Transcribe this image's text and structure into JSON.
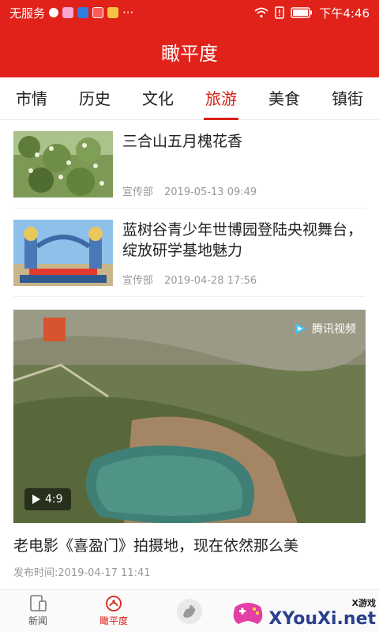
{
  "status_bar": {
    "carrier": "无服务",
    "time": "下午4:46"
  },
  "app_title": "瞰平度",
  "tabs": [
    {
      "label": "市情"
    },
    {
      "label": "历史"
    },
    {
      "label": "文化"
    },
    {
      "label": "旅游"
    },
    {
      "label": "美食"
    },
    {
      "label": "镇街"
    }
  ],
  "active_tab": "旅游",
  "news": [
    {
      "title": "三合山五月槐花香",
      "source": "宣传部",
      "date": "2019-05-13 09:49"
    },
    {
      "title": "蓝树谷青少年世博园登陆央视舞台，绽放研学基地魅力",
      "source": "宣传部",
      "date": "2019-04-28 17:56"
    }
  ],
  "video": {
    "duration": "4:9",
    "provider": "腾讯视频",
    "title": "老电影《喜盈门》拍摄地，现在依然那么美",
    "published": "发布时间:2019-04-17 11:41"
  },
  "bottom_nav": [
    {
      "label": "新闻",
      "icon": "phone-icon"
    },
    {
      "label": "瞰平度",
      "icon": "compass-icon"
    },
    {
      "label": "",
      "icon": "hand-icon"
    },
    {
      "label": "",
      "icon": "hidden-icon"
    },
    {
      "label": "",
      "icon": "hidden-icon"
    }
  ],
  "watermark": {
    "text": "XYouXi.net",
    "small": "X游戏"
  },
  "colors": {
    "primary": "#e0221a",
    "accent": "#d92016"
  }
}
